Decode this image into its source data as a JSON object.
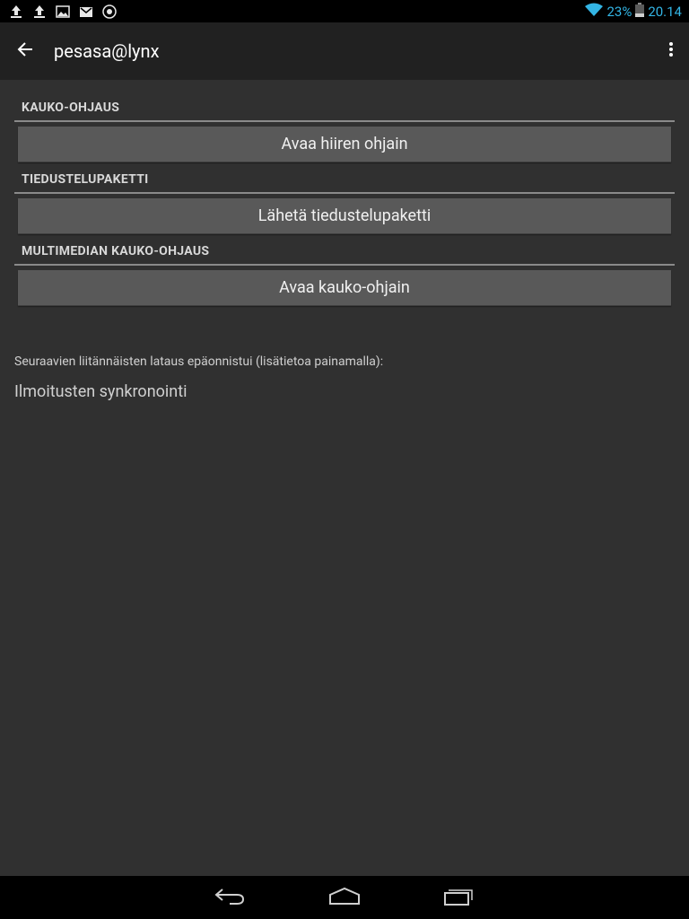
{
  "status_bar": {
    "icons": [
      "upload-icon",
      "upload-icon",
      "image-icon",
      "gmail-icon",
      "media-icon"
    ],
    "wifi_icon": "wifi-icon",
    "battery_percent": "23%",
    "battery_icon": "battery-icon",
    "time": "20.14"
  },
  "action_bar": {
    "title": "pesasa@lynx",
    "back_icon": "back-arrow-icon",
    "overflow_icon": "overflow-menu-icon"
  },
  "sections": [
    {
      "header": "KAUKO-OHJAUS",
      "button_label": "Avaa hiiren ohjain"
    },
    {
      "header": "TIEDUSTELUPAKETTI",
      "button_label": "Lähetä tiedustelupaketti"
    },
    {
      "header": "MULTIMEDIAN KAUKO-OHJAUS",
      "button_label": "Avaa kauko-ohjain"
    }
  ],
  "failed_plugins": {
    "note": "Seuraavien liitännäisten lataus epäonnistui (lisätietoa painamalla):",
    "items": [
      "Ilmoitusten synkronointi"
    ]
  },
  "nav_bar": {
    "back": "nav-back-icon",
    "home": "nav-home-icon",
    "recents": "nav-recents-icon"
  },
  "colors": {
    "background": "#303030",
    "action_bar": "#212121",
    "button": "#595959",
    "status_accent": "#33b5e5"
  }
}
